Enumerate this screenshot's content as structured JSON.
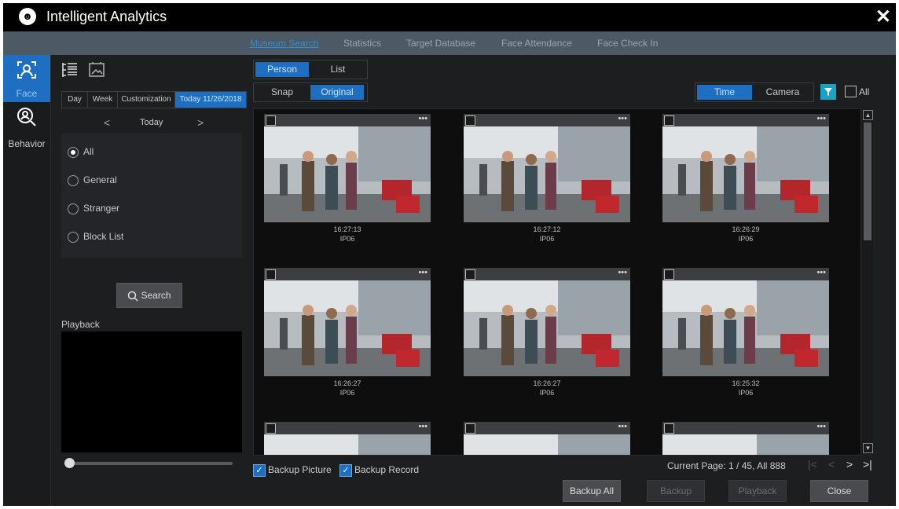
{
  "app": {
    "title": "Intelligent Analytics",
    "logo_glyph": "☻",
    "close_glyph": "✕"
  },
  "nav": {
    "tabs": [
      "Museum Search",
      "Statistics",
      "Target Database",
      "Face Attendance",
      "Face Check In"
    ]
  },
  "rail": {
    "items": [
      {
        "label": "Face",
        "icon": "face-scan-icon"
      },
      {
        "label": "Behavior",
        "icon": "magnify-person-icon"
      }
    ]
  },
  "filter": {
    "periods": [
      "Day",
      "Week",
      "Customization",
      "Today 11/26/2018"
    ],
    "date_label": "Today",
    "prev": "<",
    "next": ">",
    "options": [
      "All",
      "General",
      "Stranger",
      "Block List"
    ],
    "search_label": "Search",
    "playback_label": "Playback"
  },
  "view": {
    "mode_tabs": [
      "Person",
      "List"
    ],
    "type_tabs": [
      "Snap",
      "Original"
    ],
    "sort_tabs": [
      "Time",
      "Camera"
    ],
    "all_label": "All"
  },
  "results": [
    {
      "time": "16:27:13",
      "camera": "IP06"
    },
    {
      "time": "16:27:12",
      "camera": "IP06"
    },
    {
      "time": "16:26:29",
      "camera": "IP06"
    },
    {
      "time": "16:26:27",
      "camera": "IP06"
    },
    {
      "time": "16:26:27",
      "camera": "IP06"
    },
    {
      "time": "16:25:32",
      "camera": "IP06"
    }
  ],
  "footer": {
    "backup_picture": "Backup Picture",
    "backup_record": "Backup Record",
    "page_info": "Current Page: 1 / 45, All 888",
    "buttons": [
      "Backup All",
      "Backup",
      "Playback",
      "Close"
    ]
  },
  "colors": {
    "accent": "#1e6fc2",
    "filter_icon_bg": "#19a3c7"
  }
}
